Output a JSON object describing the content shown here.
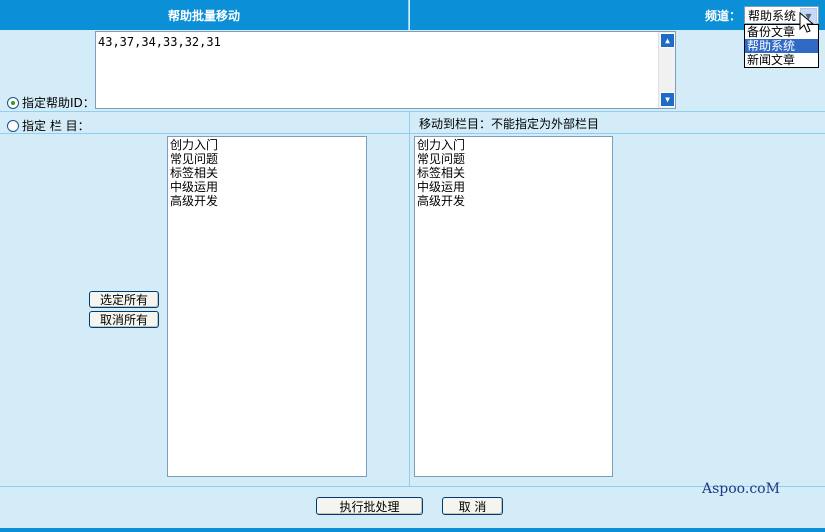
{
  "header": {
    "title": "帮助批量移动",
    "channel_label": "频道："
  },
  "channel_select": {
    "value": "帮助系统",
    "options": [
      "备份文章",
      "帮助系统",
      "新闻文章"
    ]
  },
  "ids_field": {
    "label": "指定帮助ID：",
    "value": "43,37,34,33,32,31"
  },
  "column_option": {
    "label": "指定 栏 目："
  },
  "target": {
    "label": "移动到栏目：不能指定为外部栏目"
  },
  "source_columns": [
    "创力入门",
    "常见问题",
    "标签相关",
    "中级运用",
    "高级开发"
  ],
  "target_columns": [
    "创力入门",
    "常见问题",
    "标签相关",
    "中级运用",
    "高级开发"
  ],
  "buttons": {
    "select_all": "选定所有",
    "deselect_all": "取消所有",
    "execute": "执行批处理",
    "cancel": "取 消"
  },
  "footer": {
    "brand": "Aspoo.coM"
  }
}
